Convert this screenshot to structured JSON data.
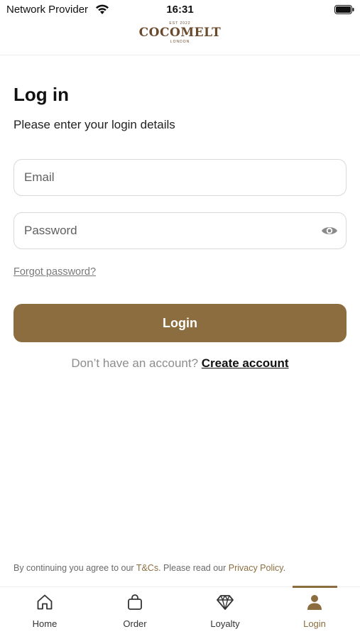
{
  "status_bar": {
    "carrier": "Network Provider",
    "time": "16:31"
  },
  "header": {
    "logo_est": "EST 2022",
    "logo_name": "COCOMELT",
    "logo_city": "LONDON"
  },
  "login": {
    "title": "Log in",
    "subtitle": "Please enter your login details",
    "email_placeholder": "Email",
    "email_value": "",
    "password_placeholder": "Password",
    "password_value": "",
    "forgot_label": "Forgot password?",
    "submit_label": "Login",
    "signup_prompt": "Don’t have an account?",
    "signup_link": "Create account"
  },
  "legal": {
    "prefix": "By continuing you agree to our ",
    "terms_link": "T&Cs",
    "middle": ". Please read our ",
    "privacy_link": "Privacy Policy",
    "suffix": "."
  },
  "tabbar": {
    "active": "Login",
    "items": [
      {
        "label": "Home",
        "icon": "home-icon"
      },
      {
        "label": "Order",
        "icon": "bag-icon"
      },
      {
        "label": "Loyalty",
        "icon": "diamond-icon"
      },
      {
        "label": "Login",
        "icon": "person-icon"
      }
    ]
  },
  "colors": {
    "accent": "#8c6d3f",
    "logo": "#6b4a2b",
    "text": "#111111",
    "muted": "#8d8d8d"
  }
}
